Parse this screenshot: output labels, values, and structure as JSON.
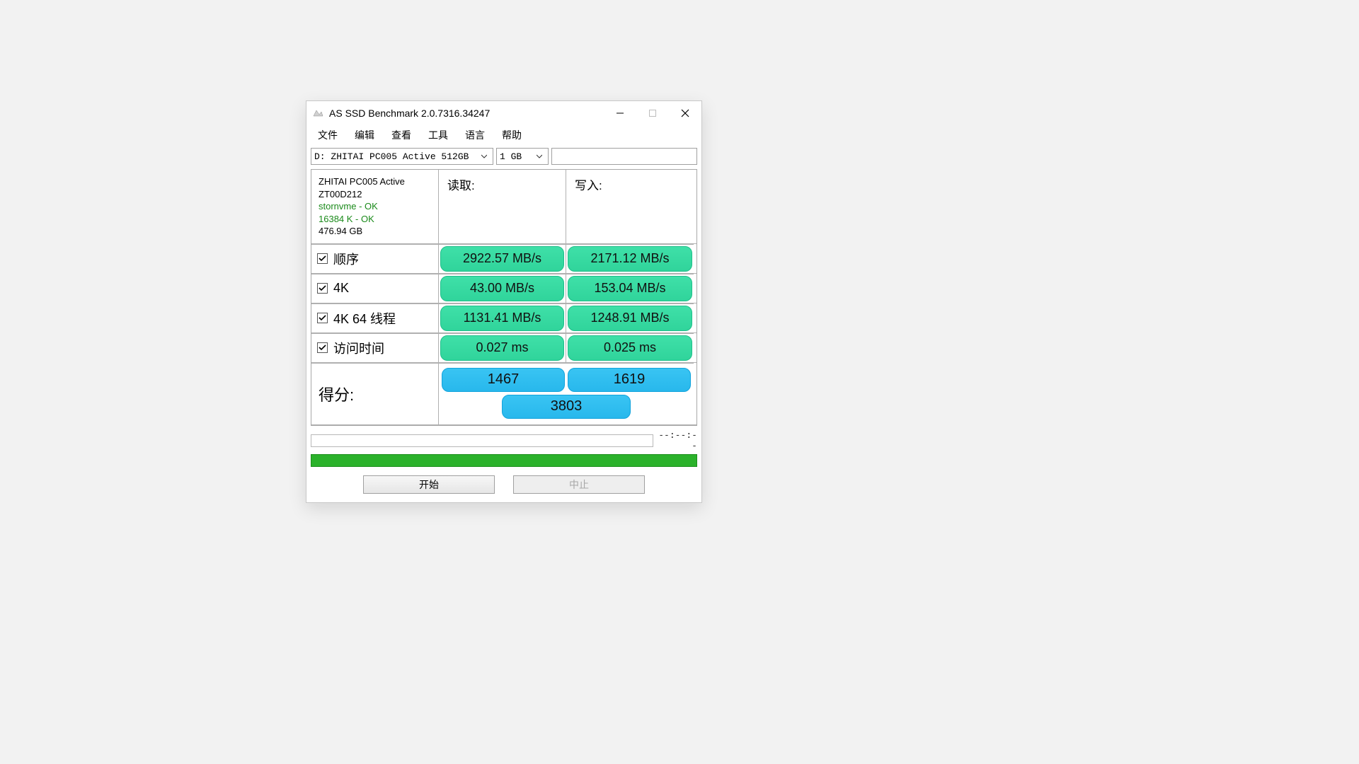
{
  "window": {
    "title": "AS SSD Benchmark 2.0.7316.34247"
  },
  "menu": [
    "文件",
    "编辑",
    "查看",
    "工具",
    "语言",
    "帮助"
  ],
  "selectors": {
    "drive": "D: ZHITAI PC005 Active 512GB",
    "size": "1 GB"
  },
  "device": {
    "name": "ZHITAI PC005 Active",
    "model": "ZT00D212",
    "driver": "stornvme - OK",
    "align": "16384 K - OK",
    "capacity": "476.94 GB"
  },
  "headers": {
    "read": "读取:",
    "write": "写入:"
  },
  "tests": [
    {
      "label": "顺序",
      "read": "2922.57 MB/s",
      "write": "2171.12 MB/s"
    },
    {
      "label": "4K",
      "read": "43.00 MB/s",
      "write": "153.04 MB/s"
    },
    {
      "label": "4K 64 线程",
      "read": "1131.41 MB/s",
      "write": "1248.91 MB/s"
    },
    {
      "label": "访问时间",
      "read": "0.027 ms",
      "write": "0.025 ms"
    }
  ],
  "score": {
    "label": "得分:",
    "read": "1467",
    "write": "1619",
    "total": "3803"
  },
  "status": {
    "time": "--:--:--"
  },
  "buttons": {
    "start": "开始",
    "stop": "中止"
  }
}
